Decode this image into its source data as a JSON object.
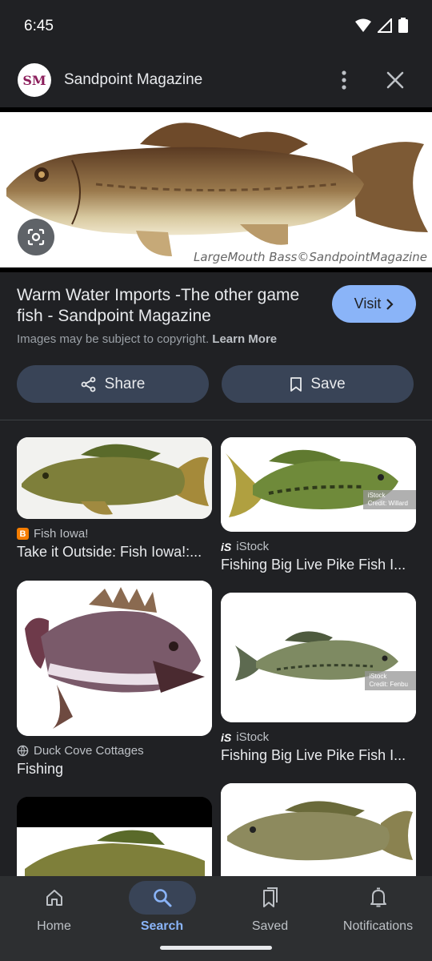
{
  "status_bar": {
    "time": "6:45"
  },
  "header": {
    "logo_text": "SM",
    "site_name": "Sandpoint Magazine"
  },
  "hero": {
    "caption": "LargeMouth Bass©SandpointMagazine"
  },
  "result": {
    "title": "Warm Water Imports -The other game fish - Sandpoint Magazine",
    "visit_label": "Visit",
    "copyright_text": "Images may be subject to copyright.",
    "learn_more": "Learn More",
    "share_label": "Share",
    "save_label": "Save"
  },
  "related": [
    {
      "source": "Fish Iowa!",
      "source_icon": "blogger-icon",
      "title": "Take it Outside: Fish Iowa!:..."
    },
    {
      "source": "iStock",
      "source_icon": "istock-icon",
      "title": "Fishing Big Live Pike Fish I...",
      "watermark": "iStock\nCredit: Willard"
    },
    {
      "source": "Duck Cove Cottages",
      "source_icon": "globe-icon",
      "title": "Fishing"
    },
    {
      "source": "iStock",
      "source_icon": "istock-icon",
      "title": "Fishing Big Live Pike Fish I...",
      "watermark": "iStock\nCredit: Fenbu"
    }
  ],
  "istock_mark": "iS",
  "bottom_nav": [
    {
      "label": "Home",
      "icon": "home-icon",
      "active": false
    },
    {
      "label": "Search",
      "icon": "search-icon",
      "active": true
    },
    {
      "label": "Saved",
      "icon": "saved-icon",
      "active": false
    },
    {
      "label": "Notifications",
      "icon": "bell-icon",
      "active": false
    }
  ],
  "colors": {
    "accent": "#8ab4f8",
    "background": "#202124",
    "button": "#394457"
  }
}
